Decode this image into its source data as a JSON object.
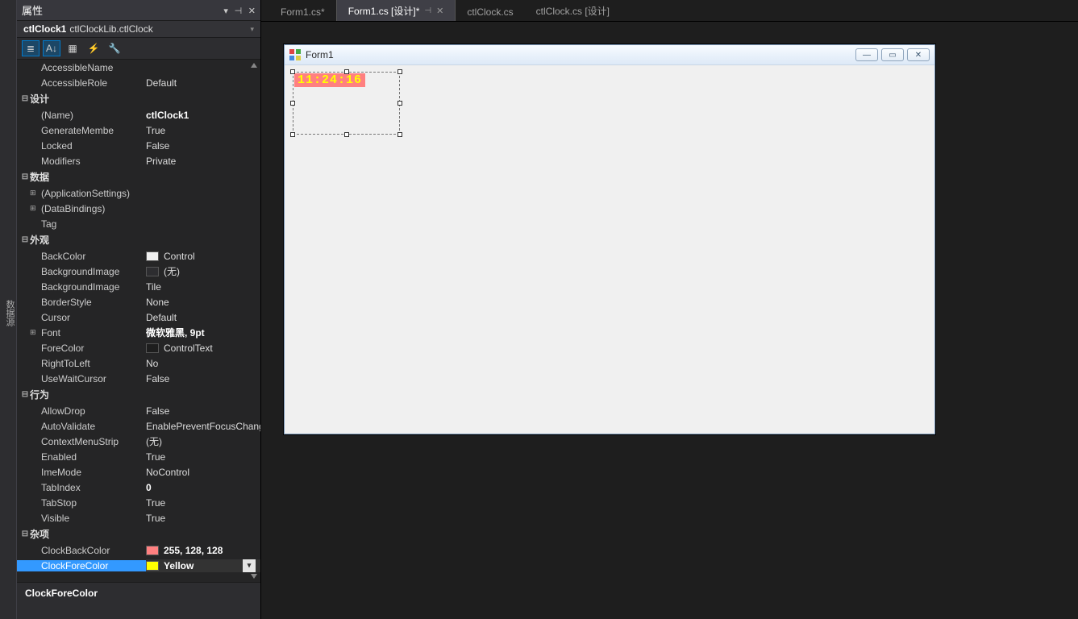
{
  "leftStrip": "数据源",
  "panel": {
    "title": "属性",
    "objectName": "ctlClock1",
    "objectType": "ctlClockLib.ctlClock"
  },
  "toolbarIcons": [
    "≣",
    "A↓",
    "▦",
    "⚡",
    "🔧"
  ],
  "categories": [
    {
      "rows": [
        {
          "name": "AccessibleName",
          "val": ""
        },
        {
          "name": "AccessibleRole",
          "val": "Default"
        }
      ]
    },
    {
      "catLabel": "设计",
      "rows": [
        {
          "name": "(Name)",
          "val": "ctlClock1",
          "bold": true
        },
        {
          "name": "GenerateMembe",
          "val": "True"
        },
        {
          "name": "Locked",
          "val": "False"
        },
        {
          "name": "Modifiers",
          "val": "Private"
        }
      ]
    },
    {
      "catLabel": "数据",
      "rows": [
        {
          "name": "(ApplicationSettings)",
          "val": "",
          "exp": true
        },
        {
          "name": "(DataBindings)",
          "val": "",
          "exp": true
        },
        {
          "name": "Tag",
          "val": ""
        }
      ]
    },
    {
      "catLabel": "外观",
      "rows": [
        {
          "name": "BackColor",
          "val": "Control",
          "swatch": "#f0f0f0"
        },
        {
          "name": "BackgroundImage",
          "val": "(无)",
          "swatch": "#2d2d30"
        },
        {
          "name": "BackgroundImage",
          "val": "Tile"
        },
        {
          "name": "BorderStyle",
          "val": "None"
        },
        {
          "name": "Cursor",
          "val": "Default"
        },
        {
          "name": "Font",
          "val": "微软雅黑, 9pt",
          "bold": true,
          "exp": true
        },
        {
          "name": "ForeColor",
          "val": "ControlText",
          "swatch": "#1e1e1e"
        },
        {
          "name": "RightToLeft",
          "val": "No"
        },
        {
          "name": "UseWaitCursor",
          "val": "False"
        }
      ]
    },
    {
      "catLabel": "行为",
      "rows": [
        {
          "name": "AllowDrop",
          "val": "False"
        },
        {
          "name": "AutoValidate",
          "val": "EnablePreventFocusChange"
        },
        {
          "name": "ContextMenuStrip",
          "val": "(无)"
        },
        {
          "name": "Enabled",
          "val": "True"
        },
        {
          "name": "ImeMode",
          "val": "NoControl"
        },
        {
          "name": "TabIndex",
          "val": "0",
          "bold": true
        },
        {
          "name": "TabStop",
          "val": "True"
        },
        {
          "name": "Visible",
          "val": "True"
        }
      ]
    },
    {
      "catLabel": "杂项",
      "rows": [
        {
          "name": "ClockBackColor",
          "val": "255, 128, 128",
          "swatch": "#ff8080",
          "bold": true
        },
        {
          "name": "ClockForeColor",
          "val": "Yellow",
          "swatch": "#ffff00",
          "bold": true,
          "selected": true,
          "dd": true
        }
      ]
    }
  ],
  "descriptor": "ClockForeColor",
  "tabs": [
    {
      "label": "Form1.cs*"
    },
    {
      "label": "Form1.cs [设计]*",
      "active": true,
      "pinned": true
    },
    {
      "label": "ctlClock.cs"
    },
    {
      "label": "ctlClock.cs [设计]"
    }
  ],
  "form": {
    "title": "Form1",
    "clockText": "11:24:16"
  }
}
